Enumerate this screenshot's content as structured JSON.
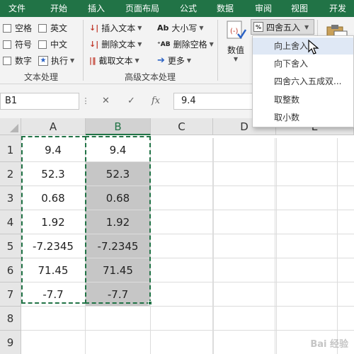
{
  "tabs": [
    "文件",
    "开始",
    "插入",
    "页面布局",
    "公式",
    "数据",
    "审阅",
    "视图",
    "开发工"
  ],
  "ribbon": {
    "checks": [
      "空格",
      "英文",
      "符号",
      "中文",
      "数字"
    ],
    "execute": "执行",
    "text_group_label": "文本处理",
    "insert_text": "插入文本",
    "delete_text": "删除文本",
    "extract_text": "截取文本",
    "case": "大小写",
    "delete_space": "删除空格",
    "more": "更多",
    "adv_group_label": "高级文本处理",
    "numeric": "数值",
    "rounding": "四舍五入"
  },
  "dropdown": {
    "items": [
      "向上舍入",
      "向下舍入",
      "四舍六入五成双...",
      "取整数",
      "取小数"
    ],
    "hovered_index": 0
  },
  "formula_bar": {
    "name_box": "B1",
    "cancel": "✕",
    "enter": "✓",
    "fx": "fx",
    "value": "9.4"
  },
  "sheet": {
    "columns": [
      "A",
      "B",
      "C",
      "D",
      "E"
    ],
    "rows": [
      "1",
      "2",
      "3",
      "4",
      "5",
      "6",
      "7",
      "8",
      "9"
    ],
    "colA": [
      "9.4",
      "52.3",
      "0.68",
      "1.92",
      "-7.2345",
      "71.45",
      "-7.7"
    ],
    "colB": [
      "9.4",
      "52.3",
      "0.68",
      "1.92",
      "-7.2345",
      "71.45",
      "-7.7"
    ]
  },
  "watermark": "Bai 经验",
  "colors": {
    "accent": "#217346",
    "selection": "#c6c6c6",
    "hover": "#dfe8f5"
  }
}
